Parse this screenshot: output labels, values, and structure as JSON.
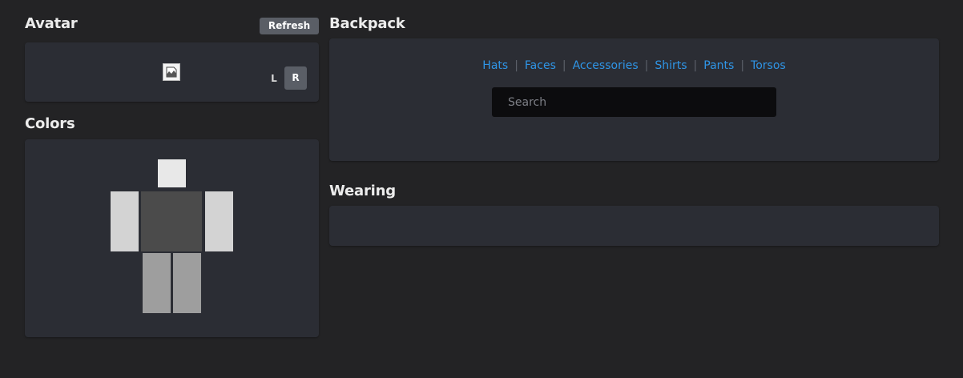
{
  "avatar": {
    "title": "Avatar",
    "refresh_label": "Refresh",
    "toggle_left": "L",
    "toggle_right": "R"
  },
  "colors": {
    "title": "Colors",
    "head_color": "#e8e8e8",
    "torso_color": "#4b4b4b",
    "left_arm_color": "#d3d3d3",
    "right_arm_color": "#d3d3d3",
    "left_leg_color": "#9e9e9e",
    "right_leg_color": "#9e9e9e"
  },
  "backpack": {
    "title": "Backpack",
    "tabs": [
      "Hats",
      "Faces",
      "Accessories",
      "Shirts",
      "Pants",
      "Torsos"
    ],
    "search_placeholder": "Search",
    "link_color": "#2f95e6"
  },
  "wearing": {
    "title": "Wearing"
  }
}
